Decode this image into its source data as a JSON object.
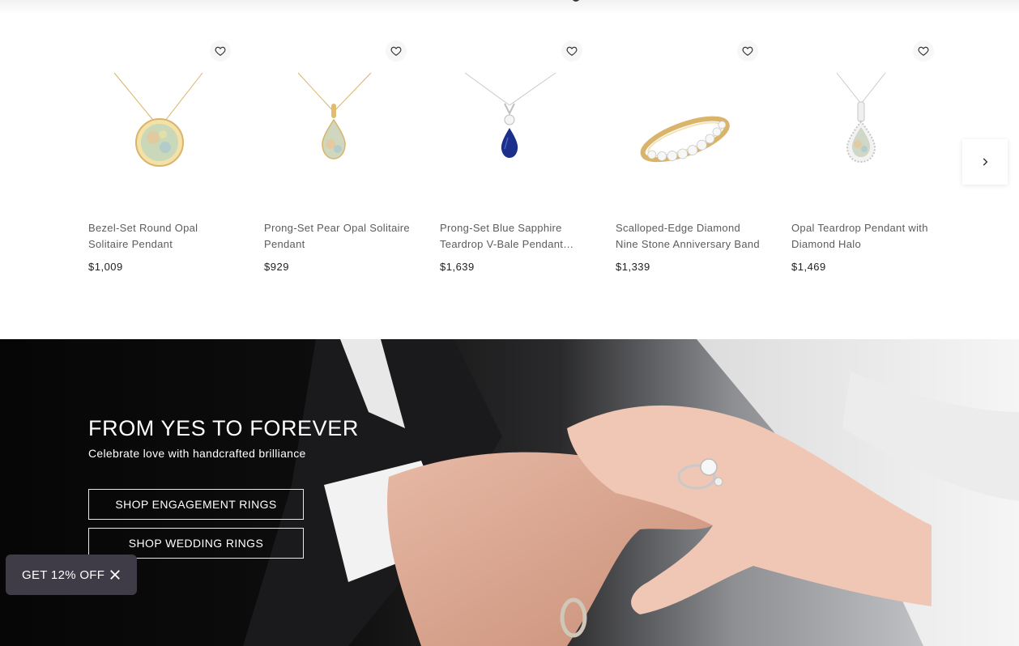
{
  "products": [
    {
      "name": "Bezel-Set Round Opal Solitaire Pendant",
      "price": "$1,009",
      "image_icon": "opal-round-pendant-icon"
    },
    {
      "name": "Prong-Set Pear Opal Solitaire Pendant",
      "price": "$929",
      "image_icon": "opal-pear-pendant-icon"
    },
    {
      "name": "Prong-Set Blue Sapphire Teardrop V-Bale Pendant with Diamond",
      "price": "$1,639",
      "image_icon": "sapphire-teardrop-pendant-icon"
    },
    {
      "name": "Scalloped-Edge Diamond Nine Stone Anniversary Band",
      "price": "$1,339",
      "image_icon": "diamond-band-ring-icon"
    },
    {
      "name": "Opal Teardrop Pendant with Diamond Halo",
      "price": "$1,469",
      "image_icon": "opal-halo-pendant-icon"
    }
  ],
  "hero": {
    "title": "FROM YES TO FOREVER",
    "subtitle": "Celebrate love with handcrafted brilliance",
    "button_engagement": "SHOP ENGAGEMENT RINGS",
    "button_wedding": "SHOP WEDDING RINGS"
  },
  "promo": {
    "label": "GET 12% OFF"
  },
  "icons": {
    "wishlist": "heart-icon",
    "next": "chevron-right-icon",
    "close": "close-icon"
  },
  "colors": {
    "gold": "#d9b46a",
    "silver": "#c9c9c9",
    "sapphire": "#1c2f8a",
    "promo_bg": "#3f3b47"
  }
}
